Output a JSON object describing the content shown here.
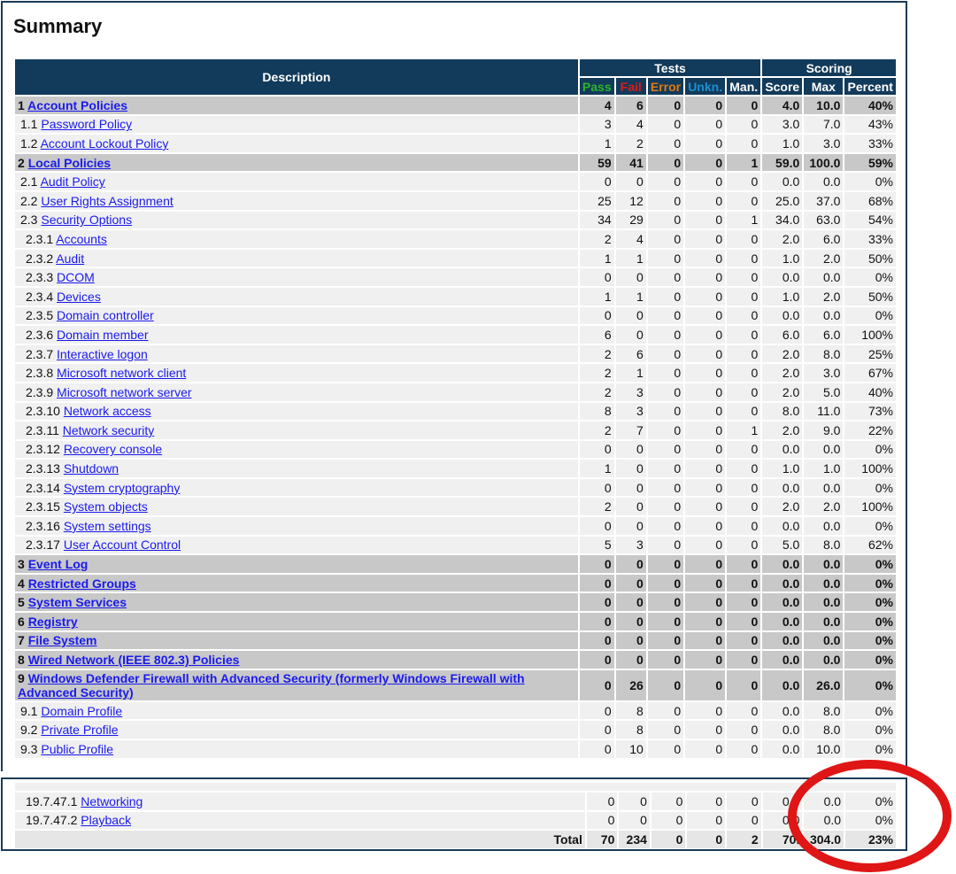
{
  "page": {
    "title": "Summary"
  },
  "headers": {
    "description": "Description",
    "tests": "Tests",
    "scoring": "Scoring",
    "pass": "Pass",
    "fail": "Fail",
    "error": "Error",
    "unkn": "Unkn.",
    "man": "Man.",
    "score": "Score",
    "max": "Max",
    "percent": "Percent"
  },
  "rows": [
    {
      "level": 1,
      "num": "1",
      "label": "Account Policies",
      "pass": "4",
      "fail": "6",
      "error": "0",
      "unkn": "0",
      "man": "0",
      "score": "4.0",
      "max": "10.0",
      "pct": "40%"
    },
    {
      "level": 2,
      "num": "1.1",
      "label": "Password Policy",
      "pass": "3",
      "fail": "4",
      "error": "0",
      "unkn": "0",
      "man": "0",
      "score": "3.0",
      "max": "7.0",
      "pct": "43%"
    },
    {
      "level": 2,
      "num": "1.2",
      "label": "Account Lockout Policy",
      "pass": "1",
      "fail": "2",
      "error": "0",
      "unkn": "0",
      "man": "0",
      "score": "1.0",
      "max": "3.0",
      "pct": "33%"
    },
    {
      "level": 1,
      "num": "2",
      "label": "Local Policies",
      "pass": "59",
      "fail": "41",
      "error": "0",
      "unkn": "0",
      "man": "1",
      "score": "59.0",
      "max": "100.0",
      "pct": "59%"
    },
    {
      "level": 2,
      "num": "2.1",
      "label": "Audit Policy",
      "pass": "0",
      "fail": "0",
      "error": "0",
      "unkn": "0",
      "man": "0",
      "score": "0.0",
      "max": "0.0",
      "pct": "0%"
    },
    {
      "level": 2,
      "num": "2.2",
      "label": "User Rights Assignment",
      "pass": "25",
      "fail": "12",
      "error": "0",
      "unkn": "0",
      "man": "0",
      "score": "25.0",
      "max": "37.0",
      "pct": "68%"
    },
    {
      "level": 2,
      "num": "2.3",
      "label": "Security Options",
      "pass": "34",
      "fail": "29",
      "error": "0",
      "unkn": "0",
      "man": "1",
      "score": "34.0",
      "max": "63.0",
      "pct": "54%"
    },
    {
      "level": 3,
      "num": "2.3.1",
      "label": "Accounts",
      "pass": "2",
      "fail": "4",
      "error": "0",
      "unkn": "0",
      "man": "0",
      "score": "2.0",
      "max": "6.0",
      "pct": "33%"
    },
    {
      "level": 3,
      "num": "2.3.2",
      "label": "Audit",
      "pass": "1",
      "fail": "1",
      "error": "0",
      "unkn": "0",
      "man": "0",
      "score": "1.0",
      "max": "2.0",
      "pct": "50%"
    },
    {
      "level": 3,
      "num": "2.3.3",
      "label": "DCOM",
      "pass": "0",
      "fail": "0",
      "error": "0",
      "unkn": "0",
      "man": "0",
      "score": "0.0",
      "max": "0.0",
      "pct": "0%"
    },
    {
      "level": 3,
      "num": "2.3.4",
      "label": "Devices",
      "pass": "1",
      "fail": "1",
      "error": "0",
      "unkn": "0",
      "man": "0",
      "score": "1.0",
      "max": "2.0",
      "pct": "50%"
    },
    {
      "level": 3,
      "num": "2.3.5",
      "label": "Domain controller",
      "pass": "0",
      "fail": "0",
      "error": "0",
      "unkn": "0",
      "man": "0",
      "score": "0.0",
      "max": "0.0",
      "pct": "0%"
    },
    {
      "level": 3,
      "num": "2.3.6",
      "label": "Domain member",
      "pass": "6",
      "fail": "0",
      "error": "0",
      "unkn": "0",
      "man": "0",
      "score": "6.0",
      "max": "6.0",
      "pct": "100%"
    },
    {
      "level": 3,
      "num": "2.3.7",
      "label": "Interactive logon",
      "pass": "2",
      "fail": "6",
      "error": "0",
      "unkn": "0",
      "man": "0",
      "score": "2.0",
      "max": "8.0",
      "pct": "25%"
    },
    {
      "level": 3,
      "num": "2.3.8",
      "label": "Microsoft network client",
      "pass": "2",
      "fail": "1",
      "error": "0",
      "unkn": "0",
      "man": "0",
      "score": "2.0",
      "max": "3.0",
      "pct": "67%"
    },
    {
      "level": 3,
      "num": "2.3.9",
      "label": "Microsoft network server",
      "pass": "2",
      "fail": "3",
      "error": "0",
      "unkn": "0",
      "man": "0",
      "score": "2.0",
      "max": "5.0",
      "pct": "40%"
    },
    {
      "level": 3,
      "num": "2.3.10",
      "label": "Network access",
      "pass": "8",
      "fail": "3",
      "error": "0",
      "unkn": "0",
      "man": "0",
      "score": "8.0",
      "max": "11.0",
      "pct": "73%"
    },
    {
      "level": 3,
      "num": "2.3.11",
      "label": "Network security",
      "pass": "2",
      "fail": "7",
      "error": "0",
      "unkn": "0",
      "man": "1",
      "score": "2.0",
      "max": "9.0",
      "pct": "22%"
    },
    {
      "level": 3,
      "num": "2.3.12",
      "label": "Recovery console",
      "pass": "0",
      "fail": "0",
      "error": "0",
      "unkn": "0",
      "man": "0",
      "score": "0.0",
      "max": "0.0",
      "pct": "0%"
    },
    {
      "level": 3,
      "num": "2.3.13",
      "label": "Shutdown",
      "pass": "1",
      "fail": "0",
      "error": "0",
      "unkn": "0",
      "man": "0",
      "score": "1.0",
      "max": "1.0",
      "pct": "100%"
    },
    {
      "level": 3,
      "num": "2.3.14",
      "label": "System cryptography",
      "pass": "0",
      "fail": "0",
      "error": "0",
      "unkn": "0",
      "man": "0",
      "score": "0.0",
      "max": "0.0",
      "pct": "0%"
    },
    {
      "level": 3,
      "num": "2.3.15",
      "label": "System objects",
      "pass": "2",
      "fail": "0",
      "error": "0",
      "unkn": "0",
      "man": "0",
      "score": "2.0",
      "max": "2.0",
      "pct": "100%"
    },
    {
      "level": 3,
      "num": "2.3.16",
      "label": "System settings",
      "pass": "0",
      "fail": "0",
      "error": "0",
      "unkn": "0",
      "man": "0",
      "score": "0.0",
      "max": "0.0",
      "pct": "0%"
    },
    {
      "level": 3,
      "num": "2.3.17",
      "label": "User Account Control",
      "pass": "5",
      "fail": "3",
      "error": "0",
      "unkn": "0",
      "man": "0",
      "score": "5.0",
      "max": "8.0",
      "pct": "62%"
    },
    {
      "level": 1,
      "num": "3",
      "label": "Event Log",
      "pass": "0",
      "fail": "0",
      "error": "0",
      "unkn": "0",
      "man": "0",
      "score": "0.0",
      "max": "0.0",
      "pct": "0%"
    },
    {
      "level": 1,
      "num": "4",
      "label": "Restricted Groups",
      "pass": "0",
      "fail": "0",
      "error": "0",
      "unkn": "0",
      "man": "0",
      "score": "0.0",
      "max": "0.0",
      "pct": "0%"
    },
    {
      "level": 1,
      "num": "5",
      "label": "System Services",
      "pass": "0",
      "fail": "0",
      "error": "0",
      "unkn": "0",
      "man": "0",
      "score": "0.0",
      "max": "0.0",
      "pct": "0%"
    },
    {
      "level": 1,
      "num": "6",
      "label": "Registry",
      "pass": "0",
      "fail": "0",
      "error": "0",
      "unkn": "0",
      "man": "0",
      "score": "0.0",
      "max": "0.0",
      "pct": "0%"
    },
    {
      "level": 1,
      "num": "7",
      "label": "File System",
      "pass": "0",
      "fail": "0",
      "error": "0",
      "unkn": "0",
      "man": "0",
      "score": "0.0",
      "max": "0.0",
      "pct": "0%"
    },
    {
      "level": 1,
      "num": "8",
      "label": "Wired Network (IEEE 802.3) Policies",
      "pass": "0",
      "fail": "0",
      "error": "0",
      "unkn": "0",
      "man": "0",
      "score": "0.0",
      "max": "0.0",
      "pct": "0%"
    },
    {
      "level": 1,
      "num": "9",
      "label": "Windows Defender Firewall with Advanced Security (formerly Windows Firewall with Advanced Security)",
      "pass": "0",
      "fail": "26",
      "error": "0",
      "unkn": "0",
      "man": "0",
      "score": "0.0",
      "max": "26.0",
      "pct": "0%",
      "tall": true
    },
    {
      "level": 2,
      "num": "9.1",
      "label": "Domain Profile",
      "pass": "0",
      "fail": "8",
      "error": "0",
      "unkn": "0",
      "man": "0",
      "score": "0.0",
      "max": "8.0",
      "pct": "0%"
    },
    {
      "level": 2,
      "num": "9.2",
      "label": "Private Profile",
      "pass": "0",
      "fail": "8",
      "error": "0",
      "unkn": "0",
      "man": "0",
      "score": "0.0",
      "max": "8.0",
      "pct": "0%"
    },
    {
      "level": 2,
      "num": "9.3",
      "label": "Public Profile",
      "pass": "0",
      "fail": "10",
      "error": "0",
      "unkn": "0",
      "man": "0",
      "score": "0.0",
      "max": "10.0",
      "pct": "0%"
    }
  ],
  "bottom_rows": [
    {
      "level": 3,
      "num": "19.7.47.1",
      "label": "Networking",
      "pass": "0",
      "fail": "0",
      "error": "0",
      "unkn": "0",
      "man": "0",
      "score": "0.0",
      "max": "0.0",
      "pct": "0%"
    },
    {
      "level": 3,
      "num": "19.7.47.2",
      "label": "Playback",
      "pass": "0",
      "fail": "0",
      "error": "0",
      "unkn": "0",
      "man": "0",
      "score": "0.0",
      "max": "0.0",
      "pct": "0%"
    }
  ],
  "total": {
    "label": "Total",
    "pass": "70",
    "fail": "234",
    "error": "0",
    "unkn": "0",
    "man": "2",
    "score": "70.",
    "max": "304.0",
    "pct": "23%"
  },
  "colors": {
    "header_bg": "#123a5a",
    "pass": "#2bb52b",
    "fail": "#e01818",
    "error": "#e07a10",
    "unkn": "#1c8fcf",
    "annotation_circle": "#e01515"
  }
}
